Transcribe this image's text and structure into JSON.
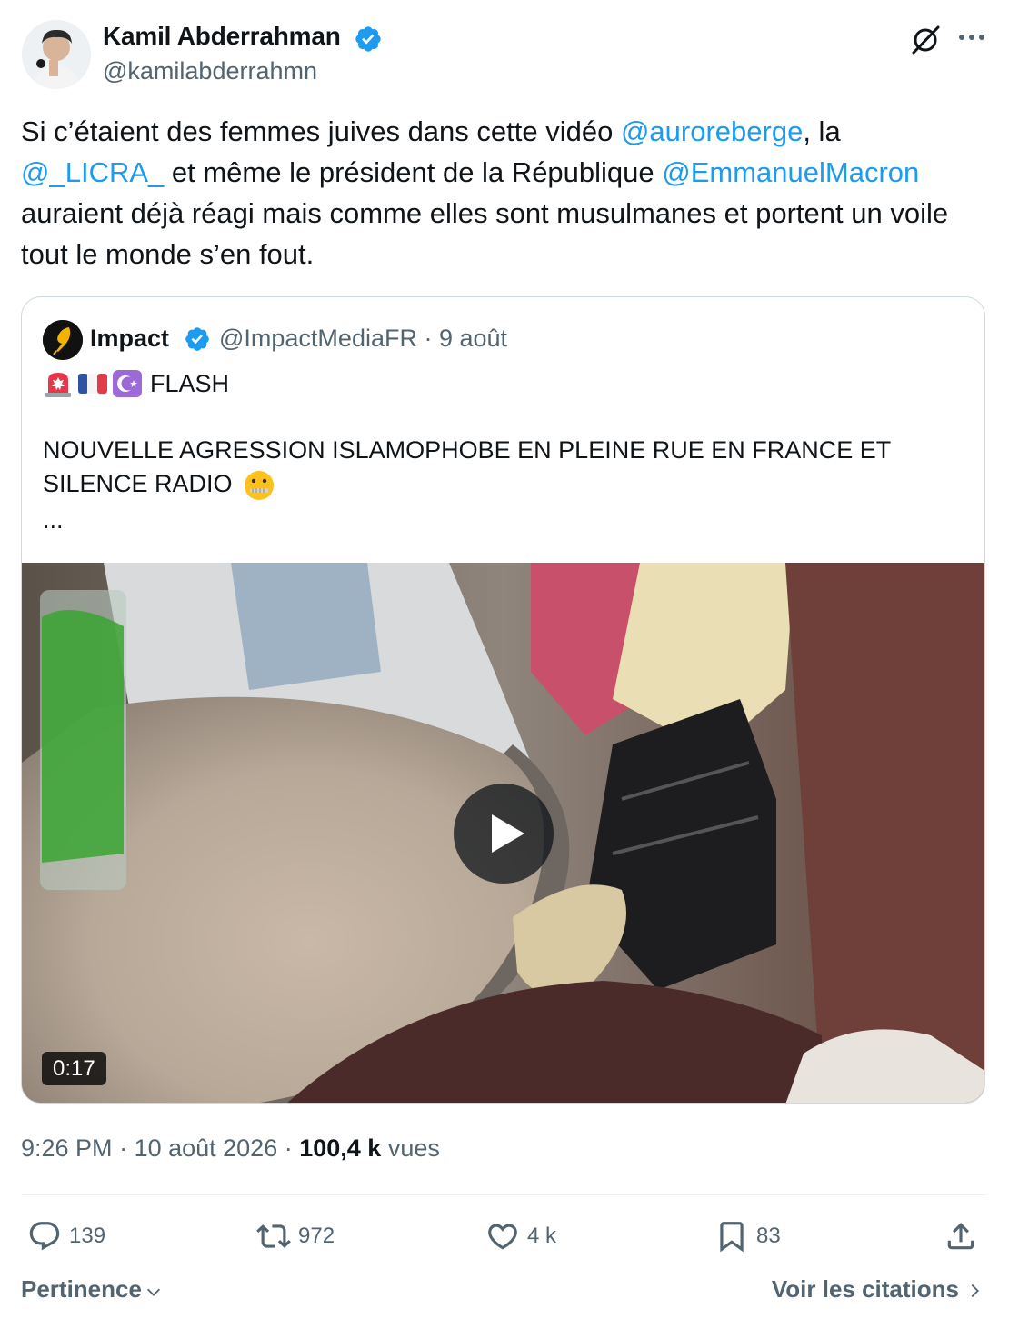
{
  "author": {
    "name": "Kamil Abderrahman",
    "handle": "@kamilabderrahmn"
  },
  "tweet": {
    "segments": [
      {
        "text": "Si c’étaient des femmes juives dans cette vidéo "
      },
      {
        "text": "@auroreberge",
        "mention": true
      },
      {
        "text": ", la "
      },
      {
        "text": "@_LICRA_",
        "mention": true
      },
      {
        "text": " et même le président de la République "
      },
      {
        "text": "@EmmanuelMacron",
        "mention": true
      },
      {
        "text": " auraient déjà réagi mais comme elles sont musulmanes et portent un voile tout le monde s’en fout."
      }
    ]
  },
  "quote": {
    "name": "Impact",
    "handle": "@ImpactMediaFR",
    "date": "9 août",
    "flash": "FLASH",
    "body": "NOUVELLE AGRESSION ISLAMOPHOBE EN PLEINE RUE EN FRANCE ET SILENCE RADIO",
    "ellipsis": "...",
    "video_duration": "0:17"
  },
  "meta": {
    "time": "9:26 PM",
    "date": "10 août 2026",
    "views_count": "100,4 k",
    "views_label": "vues"
  },
  "actions": {
    "replies": "139",
    "reposts": "972",
    "likes": "4 k",
    "bookmarks": "83"
  },
  "footer": {
    "sort_label": "Pertinence",
    "quotes_link": "Voir les citations"
  },
  "colors": {
    "accent": "#1d9bf0",
    "secondary_text": "#536471",
    "primary_text": "#0f1419"
  }
}
